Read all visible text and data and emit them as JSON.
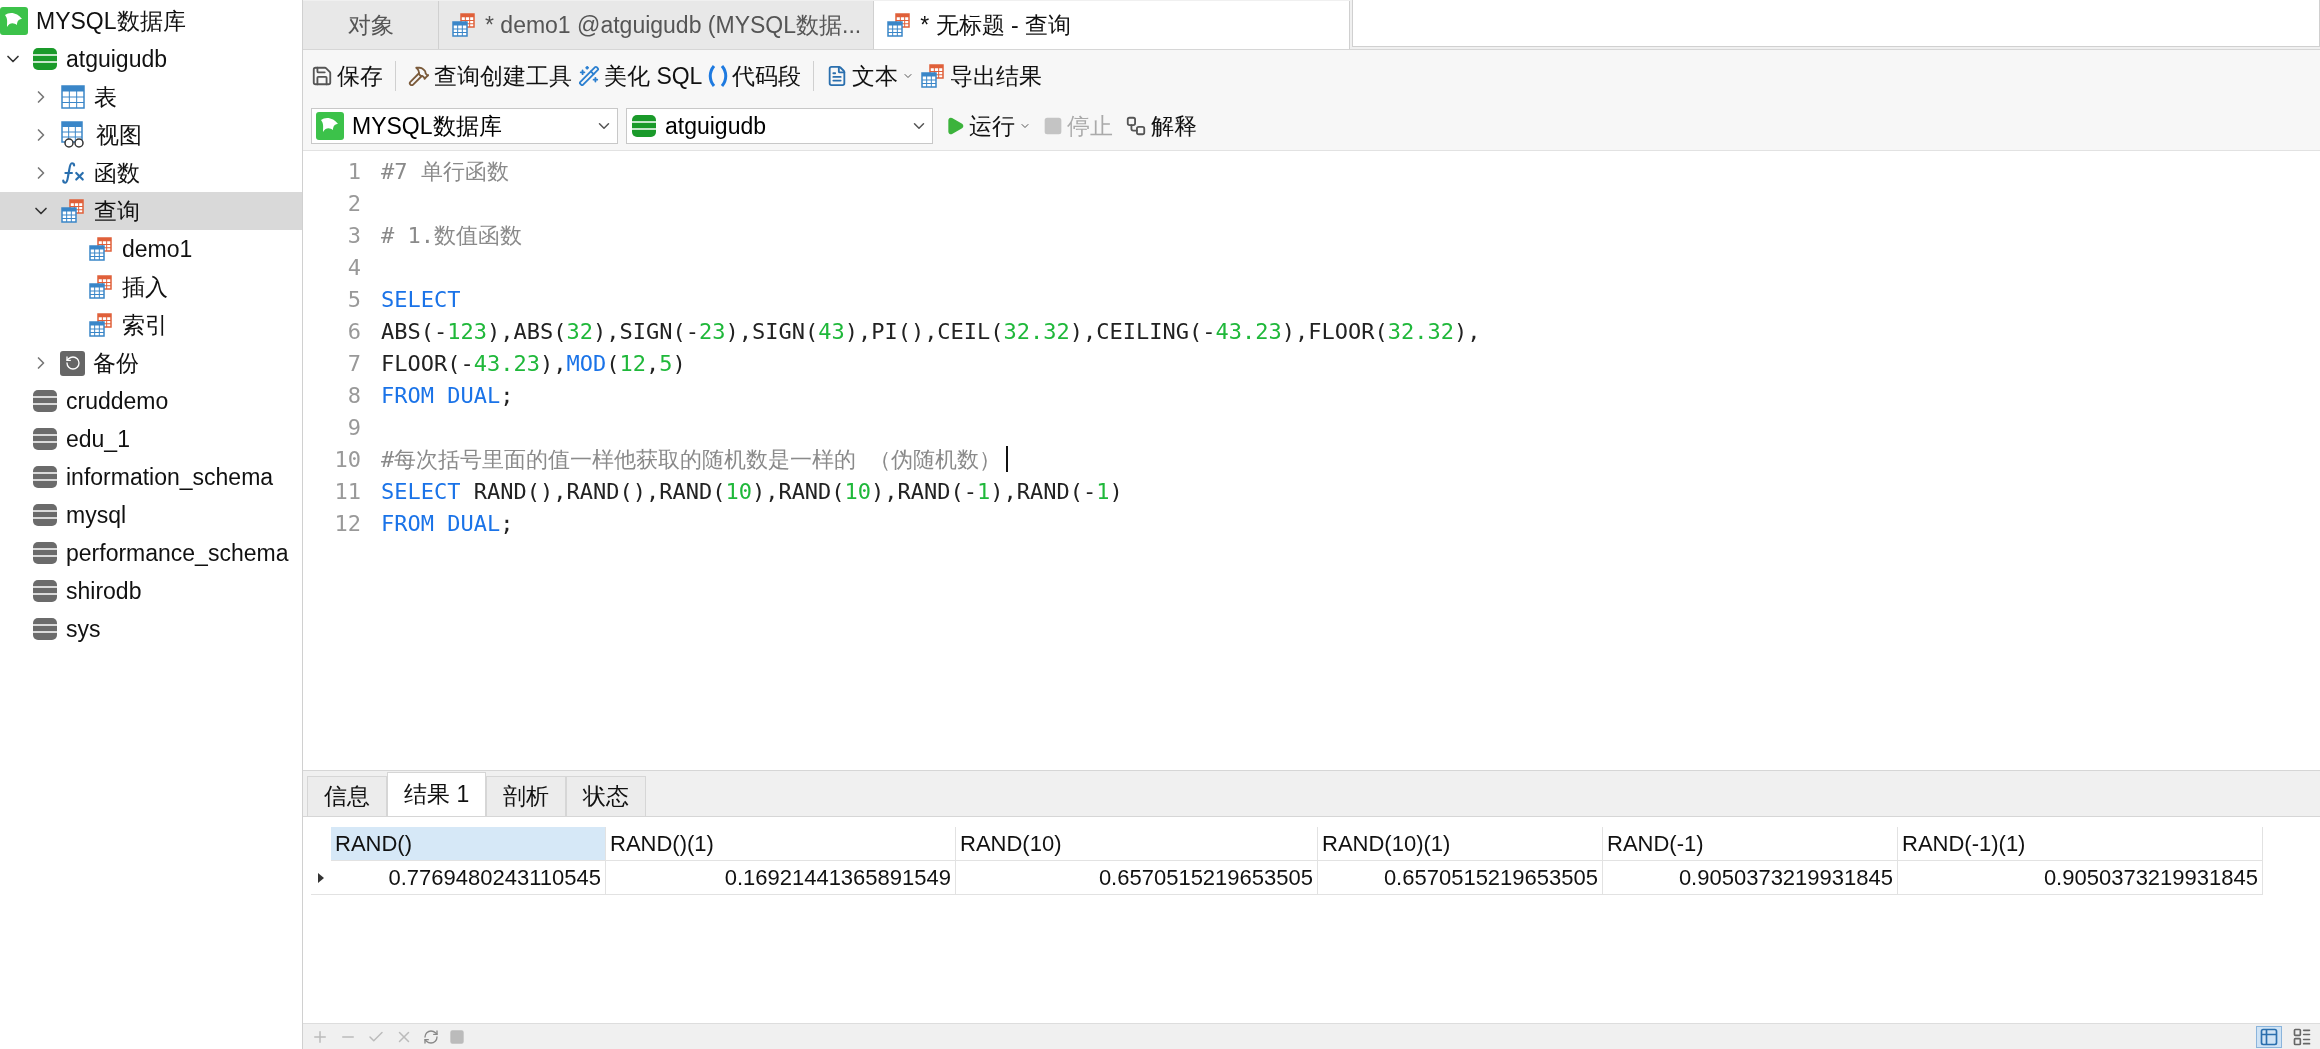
{
  "tabs": [
    {
      "label": "对象",
      "selected": false,
      "kind": "objects"
    },
    {
      "label": "* demo1 @atguigudb (MYSQL数据...",
      "selected": false,
      "kind": "query"
    },
    {
      "label": "* 无标题 - 查询",
      "selected": true,
      "kind": "query"
    }
  ],
  "sidebar": {
    "items": [
      {
        "label": "MYSQL数据库",
        "kind": "connection"
      },
      {
        "label": "atguigudb",
        "kind": "database",
        "open": true,
        "expanded": true,
        "selected": false,
        "children": [
          {
            "label": "表",
            "kind": "table",
            "expanded": false,
            "selected": false
          },
          {
            "label": "视图",
            "kind": "view",
            "expanded": false,
            "selected": false
          },
          {
            "label": "函数",
            "kind": "function",
            "expanded": false,
            "selected": false
          },
          {
            "label": "查询",
            "kind": "query",
            "expanded": true,
            "selected": true,
            "children": [
              {
                "label": "demo1",
                "kind": "query",
                "selected": false
              },
              {
                "label": "插入",
                "kind": "query",
                "selected": false
              },
              {
                "label": "索引",
                "kind": "query",
                "selected": false
              }
            ]
          },
          {
            "label": "备份",
            "kind": "backup",
            "expanded": false,
            "selected": false
          }
        ]
      },
      {
        "label": "cruddemo",
        "kind": "database",
        "open": false,
        "selected": false
      },
      {
        "label": "edu_1",
        "kind": "database",
        "open": false,
        "selected": false
      },
      {
        "label": "information_schema",
        "kind": "database",
        "open": false,
        "selected": false
      },
      {
        "label": "mysql",
        "kind": "database",
        "open": false,
        "selected": false
      },
      {
        "label": "performance_schema",
        "kind": "database",
        "open": false,
        "selected": false
      },
      {
        "label": "shirodb",
        "kind": "database",
        "open": false,
        "selected": false
      },
      {
        "label": "sys",
        "kind": "database",
        "open": false,
        "selected": false
      }
    ]
  },
  "toolbar": {
    "buttons": [
      {
        "label": "保存",
        "kind": "save",
        "dropdown": false
      },
      {
        "label": "查询创建工具",
        "kind": "builder",
        "dropdown": false
      },
      {
        "label": "美化 SQL",
        "kind": "beautify",
        "dropdown": false
      },
      {
        "label": "代码段",
        "kind": "snippet",
        "dropdown": false
      },
      {
        "label": "文本",
        "kind": "text",
        "dropdown": true
      },
      {
        "label": "导出结果",
        "kind": "export",
        "dropdown": false
      }
    ]
  },
  "connection_bar": {
    "connection": "MYSQL数据库",
    "database": "atguigudb",
    "actions": [
      {
        "label": "运行",
        "kind": "run",
        "disabled": false,
        "dropdown": true
      },
      {
        "label": "停止",
        "kind": "stop",
        "disabled": true,
        "dropdown": false
      },
      {
        "label": "解释",
        "kind": "explain",
        "disabled": false,
        "dropdown": false
      }
    ]
  },
  "editor": {
    "lines": [
      {
        "number": "1",
        "tokens": [
          {
            "kind": "comment",
            "text": "#7 单行函数"
          }
        ]
      },
      {
        "number": "2"
      },
      {
        "number": "3",
        "tokens": [
          {
            "kind": "comment",
            "text": "# 1.数值函数"
          }
        ]
      },
      {
        "number": "4"
      },
      {
        "number": "5",
        "tokens": [
          {
            "kind": "keyword",
            "text": "SELECT"
          }
        ]
      },
      {
        "number": "6",
        "tokens": [
          {
            "kind": "plain",
            "text": "ABS(-"
          },
          {
            "kind": "number",
            "text": "123"
          },
          {
            "kind": "plain",
            "text": "),ABS("
          },
          {
            "kind": "number",
            "text": "32"
          },
          {
            "kind": "plain",
            "text": "),SIGN(-"
          },
          {
            "kind": "number",
            "text": "23"
          },
          {
            "kind": "plain",
            "text": "),SIGN("
          },
          {
            "kind": "number",
            "text": "43"
          },
          {
            "kind": "plain",
            "text": "),PI(),CEIL("
          },
          {
            "kind": "number",
            "text": "32.32"
          },
          {
            "kind": "plain",
            "text": "),CEILING(-"
          },
          {
            "kind": "number",
            "text": "43.23"
          },
          {
            "kind": "plain",
            "text": "),FLOOR("
          },
          {
            "kind": "number",
            "text": "32.32"
          },
          {
            "kind": "plain",
            "text": "),"
          }
        ]
      },
      {
        "number": "7",
        "tokens": [
          {
            "kind": "plain",
            "text": "FLOOR(-"
          },
          {
            "kind": "number",
            "text": "43.23"
          },
          {
            "kind": "plain",
            "text": "),"
          },
          {
            "kind": "keyword",
            "text": "MOD"
          },
          {
            "kind": "plain",
            "text": "("
          },
          {
            "kind": "number",
            "text": "12"
          },
          {
            "kind": "plain",
            "text": ","
          },
          {
            "kind": "number",
            "text": "5"
          },
          {
            "kind": "plain",
            "text": ")"
          }
        ]
      },
      {
        "number": "8",
        "tokens": [
          {
            "kind": "keyword",
            "text": "FROM DUAL"
          },
          {
            "kind": "plain",
            "text": ";"
          }
        ]
      },
      {
        "number": "9"
      },
      {
        "number": "10",
        "cursor": true,
        "tokens": [
          {
            "kind": "comment",
            "text": "#每次括号里面的值一样他获取的随机数是一样的 （伪随机数）"
          }
        ]
      },
      {
        "number": "11",
        "tokens": [
          {
            "kind": "keyword",
            "text": "SELECT"
          },
          {
            "kind": "plain",
            "text": " RAND(),RAND(),RAND("
          },
          {
            "kind": "number",
            "text": "10"
          },
          {
            "kind": "plain",
            "text": "),RAND("
          },
          {
            "kind": "number",
            "text": "10"
          },
          {
            "kind": "plain",
            "text": "),RAND(-"
          },
          {
            "kind": "number",
            "text": "1"
          },
          {
            "kind": "plain",
            "text": "),RAND(-"
          },
          {
            "kind": "number",
            "text": "1"
          },
          {
            "kind": "plain",
            "text": ")"
          }
        ]
      },
      {
        "number": "12",
        "tokens": [
          {
            "kind": "keyword",
            "text": "FROM DUAL"
          },
          {
            "kind": "plain",
            "text": ";"
          }
        ]
      }
    ]
  },
  "result_tabs": [
    {
      "label": "信息",
      "selected": false
    },
    {
      "label": "结果 1",
      "selected": true
    },
    {
      "label": "剖析",
      "selected": false
    },
    {
      "label": "状态",
      "selected": false
    }
  ],
  "result_grid": {
    "columns": [
      {
        "label": "RAND()",
        "selected": true
      },
      {
        "label": "RAND()(1)",
        "selected": false
      },
      {
        "label": "RAND(10)",
        "selected": false
      },
      {
        "label": "RAND(10)(1)",
        "selected": false
      },
      {
        "label": "RAND(-1)",
        "selected": false
      },
      {
        "label": "RAND(-1)(1)",
        "selected": false
      }
    ],
    "rows": [
      {
        "current": true,
        "cells": [
          "0.7769480243110545",
          "0.16921441365891549",
          "0.6570515219653505",
          "0.6570515219653505",
          "0.9050373219931845",
          "0.9050373219931845"
        ]
      }
    ]
  }
}
